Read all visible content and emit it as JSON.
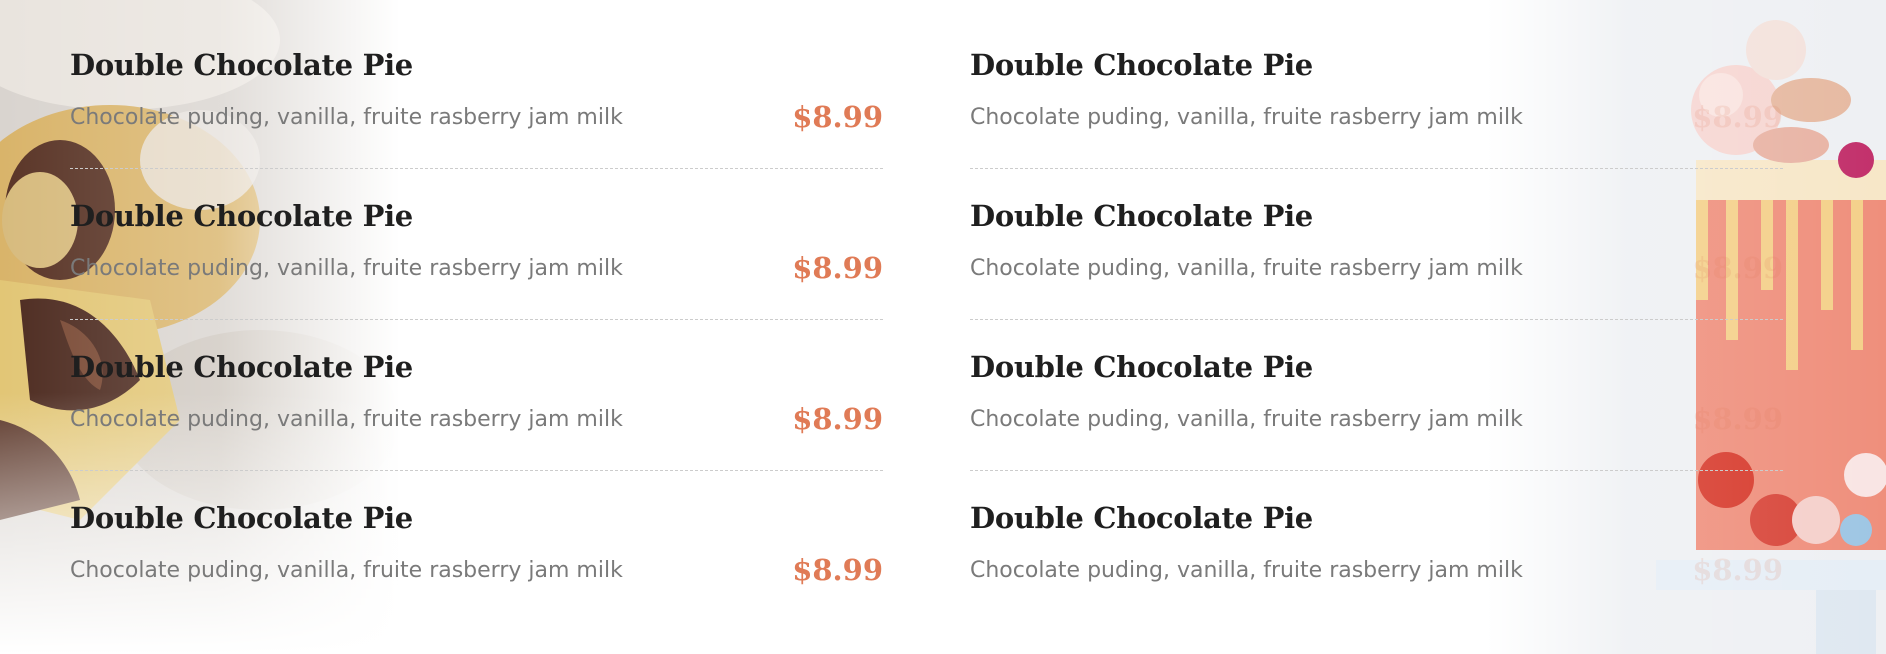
{
  "colors": {
    "accent": "#e07b56",
    "title": "#1f1f1f",
    "desc": "#7a7a7a",
    "divider": "#cccccc"
  },
  "menu_left": [
    {
      "name": "Double Chocolate Pie",
      "description": "Chocolate puding, vanilla, fruite rasberry jam milk",
      "price": "$8.99"
    },
    {
      "name": "Double Chocolate Pie",
      "description": "Chocolate puding, vanilla, fruite rasberry jam milk",
      "price": "$8.99"
    },
    {
      "name": "Double Chocolate Pie",
      "description": "Chocolate puding, vanilla, fruite rasberry jam milk",
      "price": "$8.99"
    },
    {
      "name": "Double Chocolate Pie",
      "description": "Chocolate puding, vanilla, fruite rasberry jam milk",
      "price": "$8.99"
    }
  ],
  "menu_right": [
    {
      "name": "Double Chocolate Pie",
      "description": "Chocolate puding, vanilla, fruite rasberry jam milk",
      "price": "$8.99"
    },
    {
      "name": "Double Chocolate Pie",
      "description": "Chocolate puding, vanilla, fruite rasberry jam milk",
      "price": "$8.99"
    },
    {
      "name": "Double Chocolate Pie",
      "description": "Chocolate puding, vanilla, fruite rasberry jam milk",
      "price": "$8.99"
    },
    {
      "name": "Double Chocolate Pie",
      "description": "Chocolate puding, vanilla, fruite rasberry jam milk",
      "price": "$8.99"
    }
  ]
}
